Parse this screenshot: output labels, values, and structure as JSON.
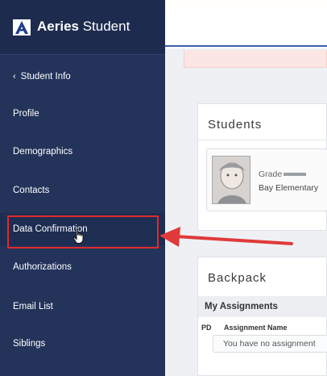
{
  "app": {
    "brand_bold": "Aeries",
    "brand_rest": " Student"
  },
  "sidebar": {
    "back_label": "Student Info",
    "items": [
      {
        "label": "Profile"
      },
      {
        "label": "Demographics"
      },
      {
        "label": "Contacts"
      },
      {
        "label": "Data Confirmation"
      },
      {
        "label": "Authorizations"
      },
      {
        "label": "Email List"
      },
      {
        "label": "Siblings"
      }
    ],
    "active_item": "Data Confirmation"
  },
  "students": {
    "title": "Students",
    "student": {
      "grade_label": "Grade",
      "school": "Bay Elementary"
    }
  },
  "backpack": {
    "title": "Backpack",
    "section": "My Assignments",
    "columns": [
      "PD",
      "Assignment Name"
    ],
    "empty_message": "You have no assignment"
  },
  "colors": {
    "sidebar_bg": "#23335a",
    "highlight": "#e02b2b",
    "arrow": "#e03a3a",
    "accent": "#3c5da8"
  }
}
